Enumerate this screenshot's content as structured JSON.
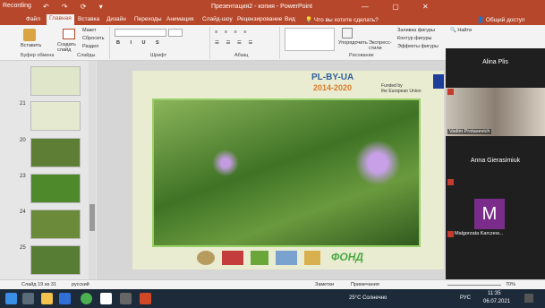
{
  "titlebar": {
    "recording": "Recording",
    "title": "Презентация2 - копия - PowerPoint",
    "qat": "↶ ↷ ⟳ ▾",
    "win": "— ▢ ✕"
  },
  "tabs": [
    "Файл",
    "Главная",
    "Вставка",
    "Дизайн",
    "Переходы",
    "Анимация",
    "Слайд-шоу",
    "Рецензирование",
    "Вид"
  ],
  "search_placeholder": "Что вы хотите сделать?",
  "share_label": "Общий доступ",
  "ribbon": {
    "paste": "Вставить",
    "new_slide": "Создать слайд",
    "layout": "Макет",
    "reset": "Сбросить",
    "section": "Раздел",
    "arrange": "Упорядочить",
    "quick_styles": "Экспресс-стили",
    "shape_fill": "Заливка фигуры",
    "shape_outline": "Контур фигуры",
    "shape_effects": "Эффекты фигуры",
    "find": "Найти",
    "groups": [
      "Буфер обмена",
      "Слайды",
      "Шрифт",
      "Абзац",
      "Рисование"
    ]
  },
  "thumbnails": [
    "21",
    "20",
    "23",
    "24",
    "25"
  ],
  "slide": {
    "logo_line1": "PL-BY-UA",
    "logo_line2": "2014-2020",
    "funded1": "Funded by",
    "funded2": "the European Union",
    "fund_text": "ФОНД"
  },
  "participants": [
    {
      "name": "Alina Plis"
    },
    {
      "name": "Vadim Protasevich"
    },
    {
      "name": "Anna Gierasimiuk"
    },
    {
      "name": "Malgorzata Karczew...",
      "initial": "M"
    }
  ],
  "status": {
    "slide": "Слайд 19 из 31",
    "lang": "русский",
    "notes": "Заметки",
    "comments": "Примечания",
    "zoom": "70%"
  },
  "taskbar": {
    "weather": "25°C Солнечно",
    "lang": "РУС",
    "time": "11:35",
    "date": "06.07.2021"
  }
}
